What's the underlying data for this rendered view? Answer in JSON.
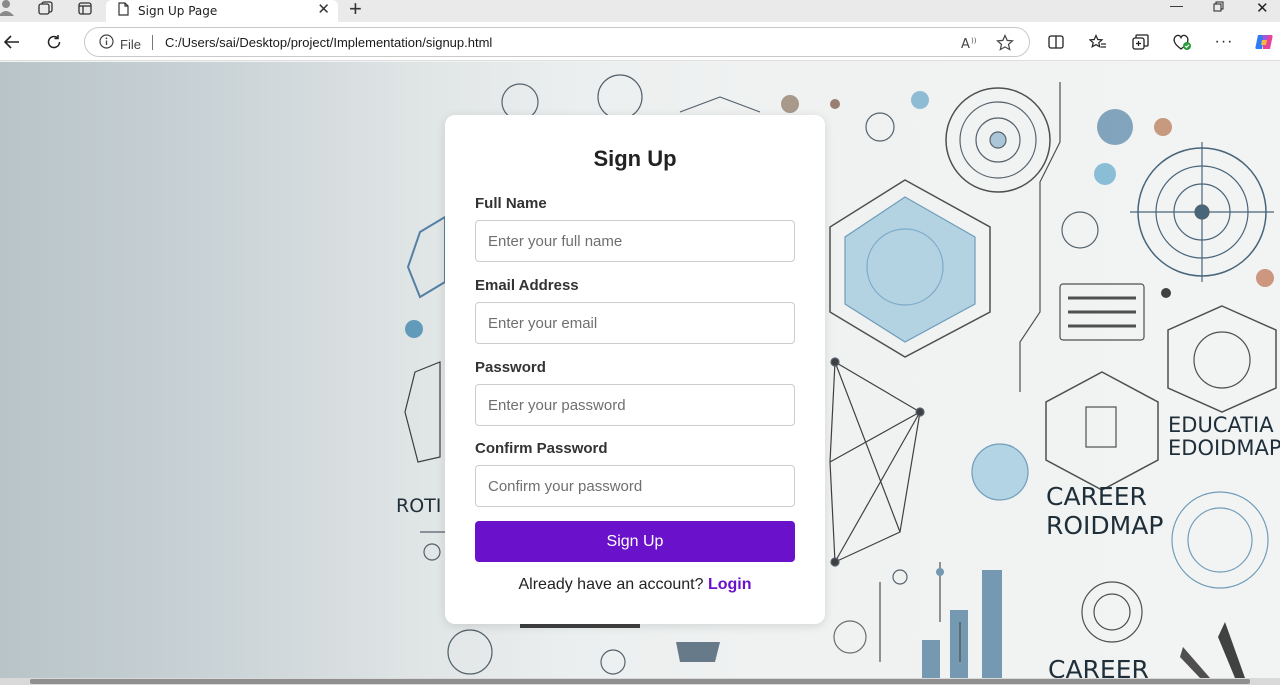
{
  "browser": {
    "tab_title": "Sign Up Page",
    "address": {
      "security_label": "File",
      "url": "C:/Users/sai/Desktop/project/Implementation/signup.html"
    }
  },
  "background": {
    "words": [
      "EDUCATIA",
      "EDOIDMAP",
      "CAREER",
      "ROIDMAP",
      "CAREER",
      "ROTI"
    ]
  },
  "form": {
    "title": "Sign Up",
    "fields": [
      {
        "label": "Full Name",
        "placeholder": "Enter your full name"
      },
      {
        "label": "Email Address",
        "placeholder": "Enter your email"
      },
      {
        "label": "Password",
        "placeholder": "Enter your password"
      },
      {
        "label": "Confirm Password",
        "placeholder": "Confirm your password"
      }
    ],
    "submit_label": "Sign Up",
    "login_prompt": "Already have an account?",
    "login_link": "Login"
  },
  "colors": {
    "accent": "#6a11cb",
    "card": "#ffffff"
  }
}
